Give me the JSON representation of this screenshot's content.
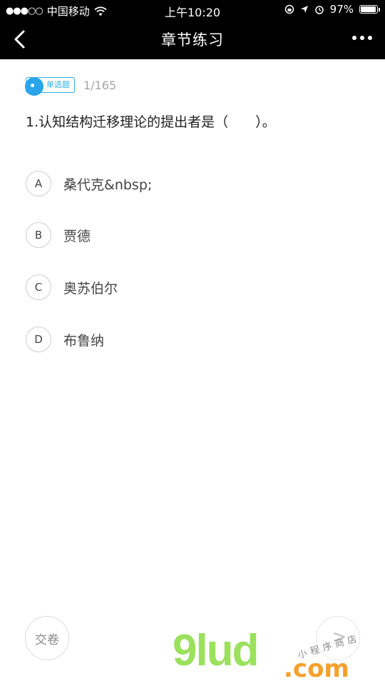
{
  "status": {
    "carrier": "中国移动",
    "time": "上午10:20",
    "battery": "97%"
  },
  "nav": {
    "title": "章节练习"
  },
  "question": {
    "type_label": "单选题",
    "counter": "1/165",
    "text": "1.认知结构迁移理论的提出者是（　　）。",
    "options": [
      {
        "letter": "A",
        "text": "桑代克&nbsp;"
      },
      {
        "letter": "B",
        "text": "贾德"
      },
      {
        "letter": "C",
        "text": "奥苏伯尔"
      },
      {
        "letter": "D",
        "text": "布鲁纳"
      }
    ]
  },
  "footer": {
    "submit_label": "交卷",
    "next_label": ">"
  },
  "watermark": {
    "main": "9lud",
    "com": ".com",
    "sub": "小程序商店"
  }
}
